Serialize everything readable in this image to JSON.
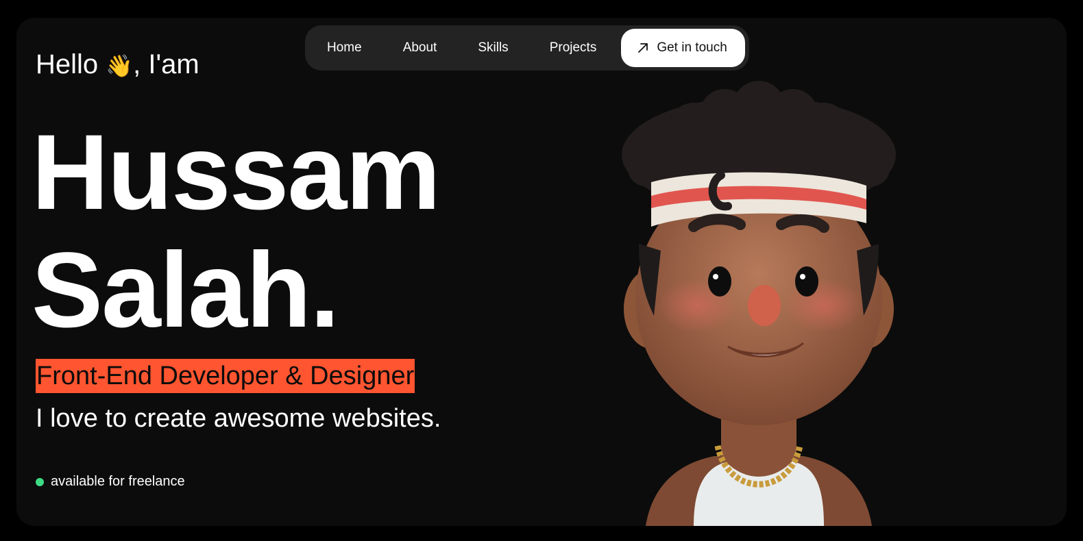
{
  "nav": {
    "items": [
      {
        "label": "Home"
      },
      {
        "label": "About"
      },
      {
        "label": "Skills"
      },
      {
        "label": "Projects"
      }
    ],
    "cta": {
      "label": "Get in touch",
      "icon": "arrow-up-right-icon"
    }
  },
  "hero": {
    "greeting_prefix": "Hello",
    "greeting_emoji": "👋",
    "greeting_suffix": ", I'am",
    "name_line1": "Hussam",
    "name_line2": "Salah.",
    "role": "Front-End Developer & Designer",
    "tagline": "I love to create awesome websites.",
    "status": "available for freelance"
  },
  "colors": {
    "background": "#000000",
    "frame": "#0c0c0c",
    "nav_bg": "#232323",
    "accent": "#ff5530",
    "status_dot": "#3ddc84"
  }
}
